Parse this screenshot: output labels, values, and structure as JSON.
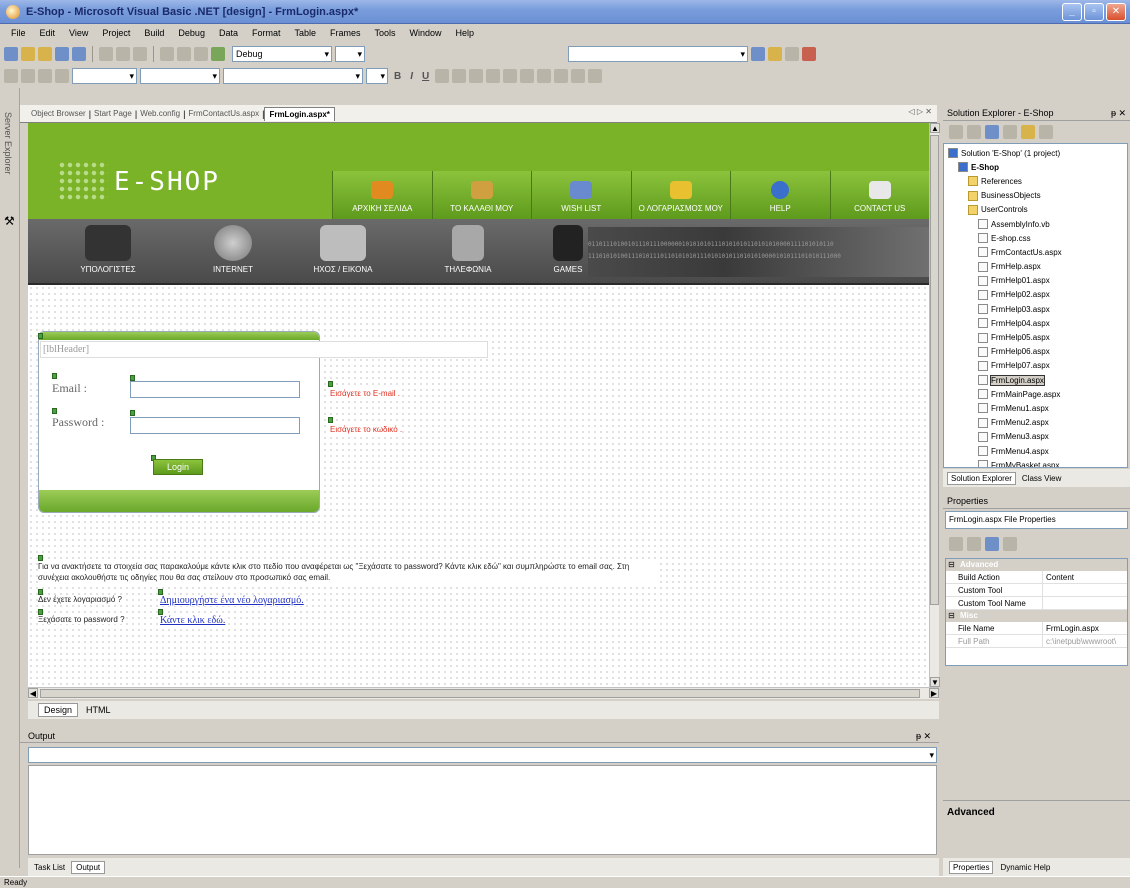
{
  "window": {
    "title": "E-Shop - Microsoft Visual Basic .NET [design] - FrmLogin.aspx*",
    "min": "_",
    "max": "▫",
    "close": "✕"
  },
  "menu": [
    "File",
    "Edit",
    "View",
    "Project",
    "Build",
    "Debug",
    "Data",
    "Format",
    "Table",
    "Frames",
    "Tools",
    "Window",
    "Help"
  ],
  "toolbar": {
    "config": "Debug",
    "format_bold": "B",
    "format_italic": "I",
    "format_underline": "U"
  },
  "sidebar": {
    "server_explorer": "Server Explorer"
  },
  "doc_tabs": [
    "Object Browser",
    "Start Page",
    "Web.config",
    "FrmContactUs.aspx",
    "FrmLogin.aspx*"
  ],
  "doc_tab_controls": "◁ ▷ ✕",
  "page": {
    "brand": "E-SHOP",
    "nav": [
      {
        "label": "ΑΡΧΙΚΗ ΣΕΛΙΔΑ",
        "icon": "home-icon",
        "color": "#e08a20"
      },
      {
        "label": "ΤΟ ΚΑΛΑΘΙ ΜΟΥ",
        "icon": "basket-icon",
        "color": "#d0a040"
      },
      {
        "label": "WISH LIST",
        "icon": "pencil-icon",
        "color": "#6a8ad0"
      },
      {
        "label": "Ο ΛΟΓΑΡΙΑΣΜΟΣ ΜΟΥ",
        "icon": "lock-icon",
        "color": "#e8c030"
      },
      {
        "label": "HELP",
        "icon": "help-icon",
        "color": "#3a6fcc"
      },
      {
        "label": "CONTACT US",
        "icon": "mail-icon",
        "color": "#e8e8e8"
      }
    ],
    "categories": [
      {
        "label": "ΥΠΟΛΟΓΙΣΤΕΣ",
        "icon": "computer-icon"
      },
      {
        "label": "INTERNET",
        "icon": "globe-icon"
      },
      {
        "label": "ΗΧΟΣ / ΕΙΚΟΝΑ",
        "icon": "projector-icon"
      },
      {
        "label": "ΤΗΛΕΦΩΝΙΑ",
        "icon": "phone-icon"
      },
      {
        "label": "GAMES",
        "icon": "gamepad-icon"
      }
    ],
    "binary_lines": [
      "01101110100101110111000000101010101110101010110101010000111101010110",
      "1110101010011101011101101010101110101010110101010000101011101010111000"
    ],
    "lbl_header": "[lblHeader]",
    "email_label": "Email :",
    "password_label": "Password :",
    "login_button": "Login",
    "email_validator": "Εισάγετε το E-mail .",
    "password_validator": "Εισάγετε το κωδικό .",
    "info_text": "Για να ανακτήσετε τα στοιχεία σας παρακαλούμε κάντε κλικ στο πεδίο που αναφέρεται ως \"Ξεχάσατε το password? Κάντε κλικ εδώ\" και συμπληρώστε το email σας. Στη συνέχεια ακολουθήστε τις οδηγίες που θα σας στείλουν στο προσωπικό σας email.",
    "no_account_text": "Δεν έχετε λογαριασμό ?",
    "create_account_link": "Δημιουργήστε ένα νέο λογαριασμό.",
    "forgot_text": "Ξεχάσατε το password ?",
    "forgot_link": "Κάντε κλικ εδώ."
  },
  "view_tabs": {
    "design": "Design",
    "html": "HTML"
  },
  "output": {
    "title": "Output",
    "pin": "ᵽ ✕"
  },
  "bottom_tabs": {
    "task_list": "Task List",
    "output": "Output"
  },
  "status": "Ready",
  "solution": {
    "title": "Solution Explorer - E-Shop",
    "pin": "ᵽ ✕",
    "items": [
      {
        "label": "Solution 'E-Shop' (1 project)",
        "indent": 0,
        "type": "proj"
      },
      {
        "label": "E-Shop",
        "indent": 1,
        "type": "proj"
      },
      {
        "label": "References",
        "indent": 2,
        "type": "fold"
      },
      {
        "label": "BusinessObjects",
        "indent": 2,
        "type": "fold"
      },
      {
        "label": "UserControls",
        "indent": 2,
        "type": "fold"
      },
      {
        "label": "AssemblyInfo.vb",
        "indent": 3,
        "type": "file"
      },
      {
        "label": "E-shop.css",
        "indent": 3,
        "type": "file"
      },
      {
        "label": "FrmContactUs.aspx",
        "indent": 3,
        "type": "file"
      },
      {
        "label": "FrmHelp.aspx",
        "indent": 3,
        "type": "file"
      },
      {
        "label": "FrmHelp01.aspx",
        "indent": 3,
        "type": "file"
      },
      {
        "label": "FrmHelp02.aspx",
        "indent": 3,
        "type": "file"
      },
      {
        "label": "FrmHelp03.aspx",
        "indent": 3,
        "type": "file"
      },
      {
        "label": "FrmHelp04.aspx",
        "indent": 3,
        "type": "file"
      },
      {
        "label": "FrmHelp05.aspx",
        "indent": 3,
        "type": "file"
      },
      {
        "label": "FrmHelp06.aspx",
        "indent": 3,
        "type": "file"
      },
      {
        "label": "FrmHelp07.aspx",
        "indent": 3,
        "type": "file"
      },
      {
        "label": "FrmLogin.aspx",
        "indent": 3,
        "type": "file",
        "selected": true
      },
      {
        "label": "FrmMainPage.aspx",
        "indent": 3,
        "type": "file"
      },
      {
        "label": "FrmMenu1.aspx",
        "indent": 3,
        "type": "file"
      },
      {
        "label": "FrmMenu2.aspx",
        "indent": 3,
        "type": "file"
      },
      {
        "label": "FrmMenu3.aspx",
        "indent": 3,
        "type": "file"
      },
      {
        "label": "FrmMenu4.aspx",
        "indent": 3,
        "type": "file"
      },
      {
        "label": "FrmMyBasket.aspx",
        "indent": 3,
        "type": "file"
      }
    ],
    "tab_solution": "Solution Explorer",
    "tab_class": "Class View"
  },
  "properties": {
    "title": "Properties",
    "selector": "FrmLogin.aspx  File Properties",
    "cat_advanced": "Advanced",
    "cat_misc": "Misc",
    "rows_advanced": [
      {
        "name": "Build Action",
        "value": "Content"
      },
      {
        "name": "Custom Tool",
        "value": ""
      },
      {
        "name": "Custom Tool Name",
        "value": ""
      }
    ],
    "rows_misc": [
      {
        "name": "File Name",
        "value": "FrmLogin.aspx"
      },
      {
        "name": "Full Path",
        "value": "c:\\inetpub\\wwwroot\\"
      }
    ],
    "desc": "Advanced",
    "tab_props": "Properties",
    "tab_help": "Dynamic Help"
  }
}
